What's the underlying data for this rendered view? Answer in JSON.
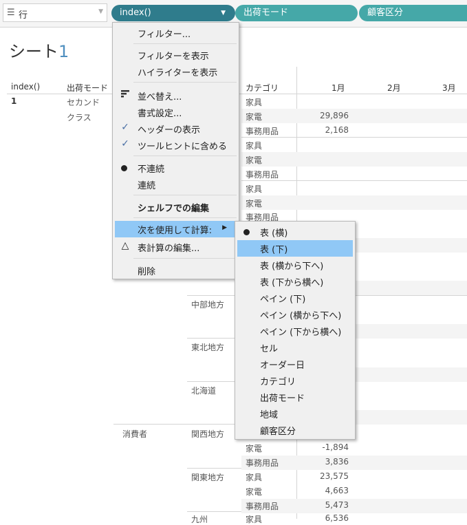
{
  "shelf": {
    "label": "行",
    "pills": [
      "index()",
      "出荷モード",
      "顧客区分"
    ]
  },
  "sheet": {
    "title_prefix": "シート",
    "title_number": "1"
  },
  "table": {
    "row_headers": [
      "index()",
      "出荷モード"
    ],
    "index_value": "1",
    "ship_mode": [
      "セカンド",
      "クラス"
    ],
    "col_category": "カテゴリ",
    "months": [
      "1月",
      "2月",
      "3月"
    ],
    "segment_consumer": "消費者",
    "regions": [
      "中部地方",
      "東北地方",
      "北海道",
      "関西地方",
      "関東地方",
      "九州"
    ],
    "rows": [
      {
        "cat": "家具",
        "v": ""
      },
      {
        "cat": "家電",
        "v": "29,896"
      },
      {
        "cat": "事務用品",
        "v": "2,168"
      },
      {
        "cat": "家具",
        "v": ""
      },
      {
        "cat": "家電",
        "v": ""
      },
      {
        "cat": "事務用品",
        "v": ""
      },
      {
        "cat": "家具",
        "v": ""
      },
      {
        "cat": "家電",
        "v": ""
      },
      {
        "cat": "事務用品",
        "v": ""
      }
    ],
    "bottom_rows": [
      {
        "cat": "家電",
        "v": "-1,894"
      },
      {
        "cat": "事務用品",
        "v": "3,836"
      },
      {
        "cat": "家具",
        "v": "23,575"
      },
      {
        "cat": "家電",
        "v": "4,663"
      },
      {
        "cat": "事務用品",
        "v": "5,473"
      },
      {
        "cat": "家具",
        "v": "6,536"
      }
    ]
  },
  "context_menu": {
    "items": {
      "filter": "フィルター...",
      "show_filter": "フィルターを表示",
      "show_highlighter": "ハイライターを表示",
      "sort": "並べ替え...",
      "format": "書式設定...",
      "show_header": "ヘッダーの表示",
      "include_tooltip": "ツールヒントに含める",
      "discrete": "不連続",
      "continuous": "連続",
      "edit_in_shelf": "シェルフでの編集",
      "compute_using": "次を使用して計算:",
      "edit_table_calc": "表計算の編集...",
      "remove": "削除"
    }
  },
  "submenu": {
    "items": [
      "表 (横)",
      "表 (下)",
      "表 (横から下へ)",
      "表 (下から横へ)",
      "ペイン (下)",
      "ペイン (横から下へ)",
      "ペイン (下から横へ)",
      "セル",
      "オーダー日",
      "カテゴリ",
      "出荷モード",
      "地域",
      "顧客区分"
    ],
    "selected": "表 (横)",
    "highlighted": "表 (下)"
  },
  "colors": {
    "pill_green": "#45a8a8",
    "pill_active": "#2f7c8c",
    "menu_highlight": "#90c8f6",
    "check_blue": "#4a6fa5"
  }
}
